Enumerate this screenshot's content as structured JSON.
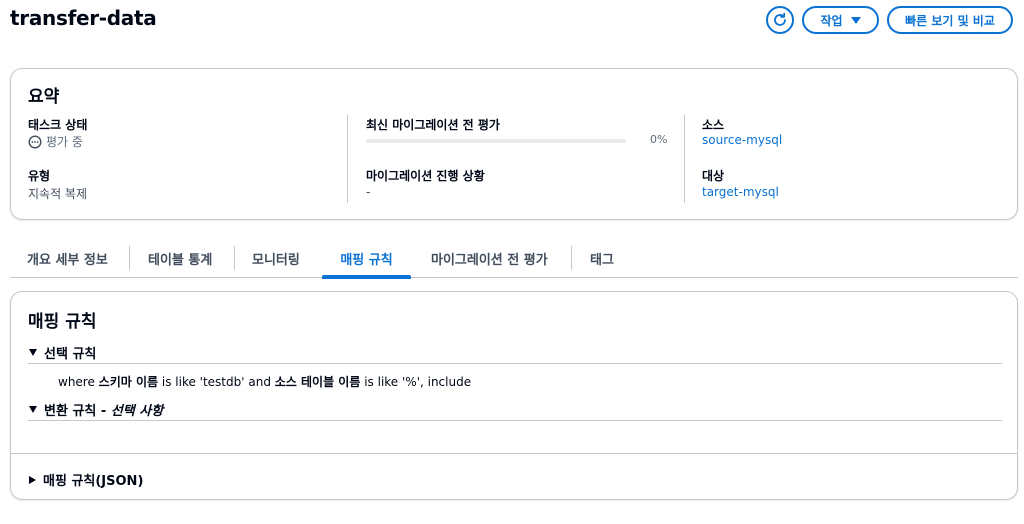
{
  "header": {
    "title": "transfer-data",
    "action_label": "작업",
    "compare_label": "빠른 보기 및 비교"
  },
  "summary": {
    "title": "요약",
    "task_status_label": "태스크 상태",
    "task_status_value": "평가 중",
    "type_label": "유형",
    "type_value": "지속적 복제",
    "premigration_label": "최신 마이그레이션 전 평가",
    "premigration_progress": 0,
    "premigration_percent_text": "0%",
    "migration_progress_label": "마이그레이션 진행 상황",
    "migration_progress_value": "-",
    "source_label": "소스",
    "source_value": "source-mysql",
    "target_label": "대상",
    "target_value": "target-mysql"
  },
  "tabs": [
    {
      "label": "개요 세부 정보"
    },
    {
      "label": "테이블 통계"
    },
    {
      "label": "모니터링"
    },
    {
      "label": "매핑 규칙"
    },
    {
      "label": "마이그레이션 전 평가"
    },
    {
      "label": "태그"
    }
  ],
  "active_tab": "매핑 규칙",
  "mapping": {
    "title": "매핑 규칙",
    "selection_rules_label": "선택 규칙",
    "rule": {
      "p1": "where ",
      "schema_label": "스키마 이름",
      "p2": " is like 'testdb' and ",
      "table_label": "소스 테이블 이름",
      "p3": " is like '%', include"
    },
    "transform_rules_label": "변환 규칙 - ",
    "transform_optional": "선택 사항",
    "json_label": "매핑 규칙(JSON)"
  },
  "colors": {
    "accent": "#0972d3",
    "text": "#000716",
    "border": "#c6c6cd"
  },
  "icons": {
    "refresh": "refresh-icon",
    "status": "status-in-progress-icon",
    "caret": "caret-down-icon"
  }
}
